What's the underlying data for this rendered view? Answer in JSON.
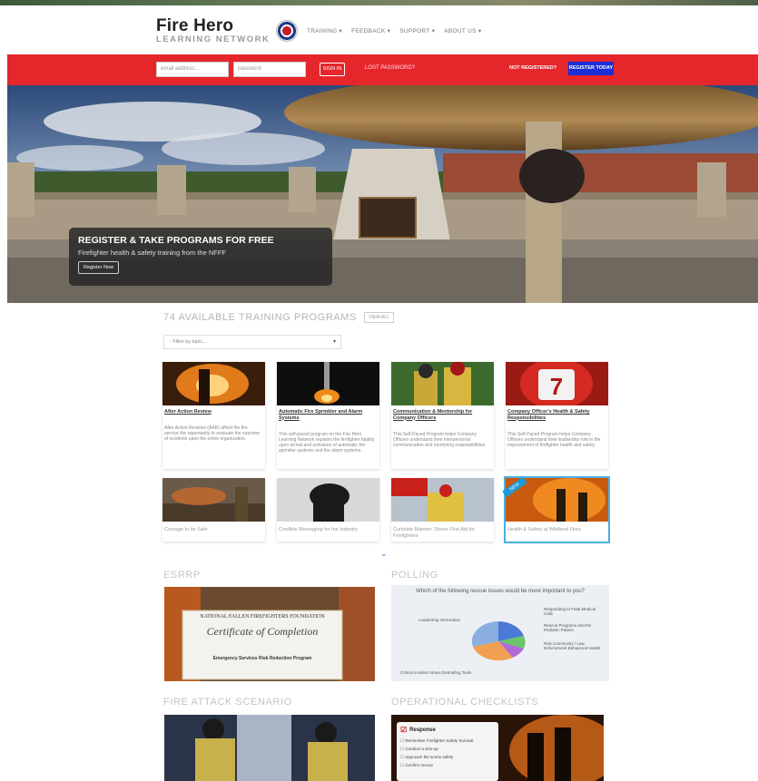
{
  "header": {
    "logo_title": "Fire Hero",
    "logo_sub": "LEARNING NETWORK",
    "nav": [
      "TRAINING ▾",
      "FEEDBACK ▾",
      "SUPPORT ▾",
      "ABOUT US ▾"
    ]
  },
  "auth": {
    "email_placeholder": "email address...",
    "password_placeholder": "password",
    "signin": "SIGN IN",
    "forgot": "LOST PASSWORD?",
    "not_registered": "NOT REGISTERED?",
    "register": "REGISTER TODAY"
  },
  "hero": {
    "title": "REGISTER & TAKE PROGRAMS FOR FREE",
    "subtitle": "Firefighter health & safety training from the NFFF",
    "button": "Register Now"
  },
  "programs": {
    "title": "74 AVAILABLE TRAINING PROGRAMS",
    "view_all": "VIEW ALL",
    "filter": "- Filter by topic...",
    "cards": [
      {
        "title": "After Action Review",
        "desc": "After Action Reviews (AAR) afford the fire service the opportunity to evaluate the outcome of incidents upon the entire organization."
      },
      {
        "title": "Automatic Fire Sprinkler and Alarm Systems",
        "desc": "This self-paced program on the Fire Hero Learning Network explains the firefighter fatality upon arrival and activation of automatic fire sprinkler systems and the alarm systems."
      },
      {
        "title": "Communication & Mentorship for Company Officers",
        "desc": "This Self-Paced Program helps Company Officers understand their interpersonal communication and mentoring responsibilities."
      },
      {
        "title": "Company Officer's Health & Safety Responsibilities",
        "desc": "This Self-Paced Program helps Company Officers understand their leadership role in the improvement of firefighter health and safety."
      }
    ],
    "cards_row2": [
      "Courage to be Safe",
      "Credible Messaging for the Industry",
      "Curbside Manner: Stress First Aid for Firefighters",
      "Health & Safety at Wildland Fires"
    ],
    "new_label": "NEW"
  },
  "sections": {
    "esrrp": "ESRRP",
    "polling": "POLLING",
    "fire_attack": "FIRE ATTACK SCENARIO",
    "checklists": "OPERATIONAL CHECKLISTS"
  },
  "certificate": {
    "org": "NATIONAL FALLEN FIREFIGHTERS FOUNDATION",
    "heading": "Certificate of Completion",
    "program": "Emergency Services Risk Reduction Program"
  },
  "poll": {
    "question": "Which of the following rescue issues would be more important to you?",
    "labels": [
      "Leadership Information",
      "Responding to Fatal Medical Calls",
      "Rescue Programs and the Pediatric Patient",
      "Risk Community / Law Enforcement Behavioral Health",
      "Critical Incident Stress Debriefing Tools"
    ]
  },
  "checklist": {
    "title": "Response",
    "items": [
      "Remember Firefighter Safety Survival",
      "Conduct a size-up",
      "Approach the scene safely",
      "Confirm rescue"
    ]
  },
  "colors": {
    "red_bar": "#e5262b",
    "register_button": "#1b2fd6",
    "accent_blue": "#1c9ad6"
  }
}
